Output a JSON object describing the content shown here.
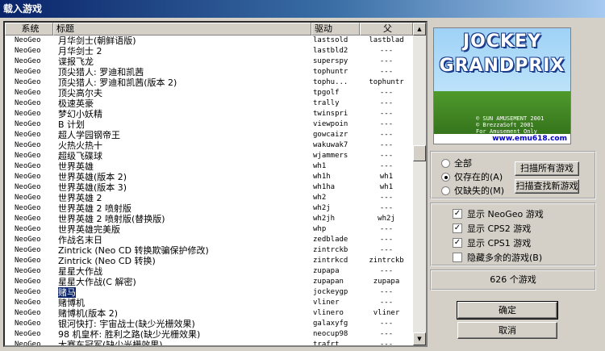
{
  "window": {
    "title": "载入游戏"
  },
  "list": {
    "columns": {
      "system": "系统",
      "title": "标题",
      "driver": "驱动",
      "parent": "父"
    },
    "rows": [
      {
        "system": "NeoGeo",
        "title": "月华剑士(朝鲜语版)",
        "driver": "lastsold",
        "parent": "lastblad"
      },
      {
        "system": "NeoGeo",
        "title": "月华剑士 2",
        "driver": "lastbld2",
        "parent": "---"
      },
      {
        "system": "NeoGeo",
        "title": "谍报飞龙",
        "driver": "superspy",
        "parent": "---"
      },
      {
        "system": "NeoGeo",
        "title": "顶尖猎人: 罗迪和凯茜",
        "driver": "tophuntr",
        "parent": "---"
      },
      {
        "system": "NeoGeo",
        "title": "顶尖猎人: 罗迪和凯茜(版本 2)",
        "driver": "tophu...",
        "parent": "tophuntr"
      },
      {
        "system": "NeoGeo",
        "title": "顶尖高尔夫",
        "driver": "tpgolf",
        "parent": "---"
      },
      {
        "system": "NeoGeo",
        "title": "极速英豪",
        "driver": "trally",
        "parent": "---"
      },
      {
        "system": "NeoGeo",
        "title": "梦幻小妖精",
        "driver": "twinspri",
        "parent": "---"
      },
      {
        "system": "NeoGeo",
        "title": "B 计划",
        "driver": "viewpoin",
        "parent": "---"
      },
      {
        "system": "NeoGeo",
        "title": "超人学园钢帝王",
        "driver": "gowcaizr",
        "parent": "---"
      },
      {
        "system": "NeoGeo",
        "title": "火热火热十",
        "driver": "wakuwak7",
        "parent": "---"
      },
      {
        "system": "NeoGeo",
        "title": "超级飞碟球",
        "driver": "wjammers",
        "parent": "---"
      },
      {
        "system": "NeoGeo",
        "title": "世界英雄",
        "driver": "wh1",
        "parent": "---"
      },
      {
        "system": "NeoGeo",
        "title": "世界英雄(版本 2)",
        "driver": "wh1h",
        "parent": "wh1"
      },
      {
        "system": "NeoGeo",
        "title": "世界英雄(版本 3)",
        "driver": "wh1ha",
        "parent": "wh1"
      },
      {
        "system": "NeoGeo",
        "title": "世界英雄 2",
        "driver": "wh2",
        "parent": "---"
      },
      {
        "system": "NeoGeo",
        "title": "世界英雄 2 喷射版",
        "driver": "wh2j",
        "parent": "---"
      },
      {
        "system": "NeoGeo",
        "title": "世界英雄 2 喷射版(替换版)",
        "driver": "wh2jh",
        "parent": "wh2j"
      },
      {
        "system": "NeoGeo",
        "title": "世界英雄完美版",
        "driver": "whp",
        "parent": "---"
      },
      {
        "system": "NeoGeo",
        "title": "作战名末日",
        "driver": "zedblade",
        "parent": "---"
      },
      {
        "system": "NeoGeo",
        "title": "Zintrick (Neo CD 转换欺骗保护修改)",
        "driver": "zintrckb",
        "parent": "---"
      },
      {
        "system": "NeoGeo",
        "title": "Zintrick (Neo CD 转换)",
        "driver": "zintrkcd",
        "parent": "zintrckb"
      },
      {
        "system": "NeoGeo",
        "title": "星星大作战",
        "driver": "zupapa",
        "parent": "---"
      },
      {
        "system": "NeoGeo",
        "title": "星星大作战(C 解密)",
        "driver": "zupapan",
        "parent": "zupapa"
      },
      {
        "system": "NeoGeo",
        "title": "赌马",
        "driver": "jockeygp",
        "parent": "---",
        "selected": true
      },
      {
        "system": "NeoGeo",
        "title": "赌博机",
        "driver": "vliner",
        "parent": "---"
      },
      {
        "system": "NeoGeo",
        "title": "赌博机(版本 2)",
        "driver": "vlinero",
        "parent": "vliner"
      },
      {
        "system": "NeoGeo",
        "title": "银河快打: 宇宙战士(缺少光栅效果)",
        "driver": "galaxyfg",
        "parent": "---"
      },
      {
        "system": "NeoGeo",
        "title": "98 机皇杯: 胜利之路(缺少光栅效果)",
        "driver": "neocup98",
        "parent": "---"
      },
      {
        "system": "NeoGeo",
        "title": "大赛车冠军(缺少光栅效果)",
        "driver": "trafrt",
        "parent": "---"
      }
    ]
  },
  "preview": {
    "logo_line1": "JOCKEY",
    "logo_line2": "GRANDPRIX",
    "copyright_line1": "© SUN AMUSEMENT 2001",
    "copyright_line2": "© BrezzaSoft 2001",
    "copyright_line3": "For Amusement Only",
    "url": "www.emu618.com"
  },
  "filter": {
    "all": "全部",
    "available": "仅存在的(A)",
    "missing": "仅缺失的(M)",
    "selected": "available"
  },
  "scan": {
    "scan_all": "扫描所有游戏",
    "scan_new": "扫描查找新游戏"
  },
  "options": {
    "show_neogeo": "显示 NeoGeo 游戏",
    "show_cps2": "显示 CPS2 游戏",
    "show_cps1": "显示 CPS1 游戏",
    "hide_extra": "隐藏多余的游戏(B)"
  },
  "count_text": "626 个游戏",
  "buttons": {
    "ok": "确定",
    "cancel": "取消"
  }
}
